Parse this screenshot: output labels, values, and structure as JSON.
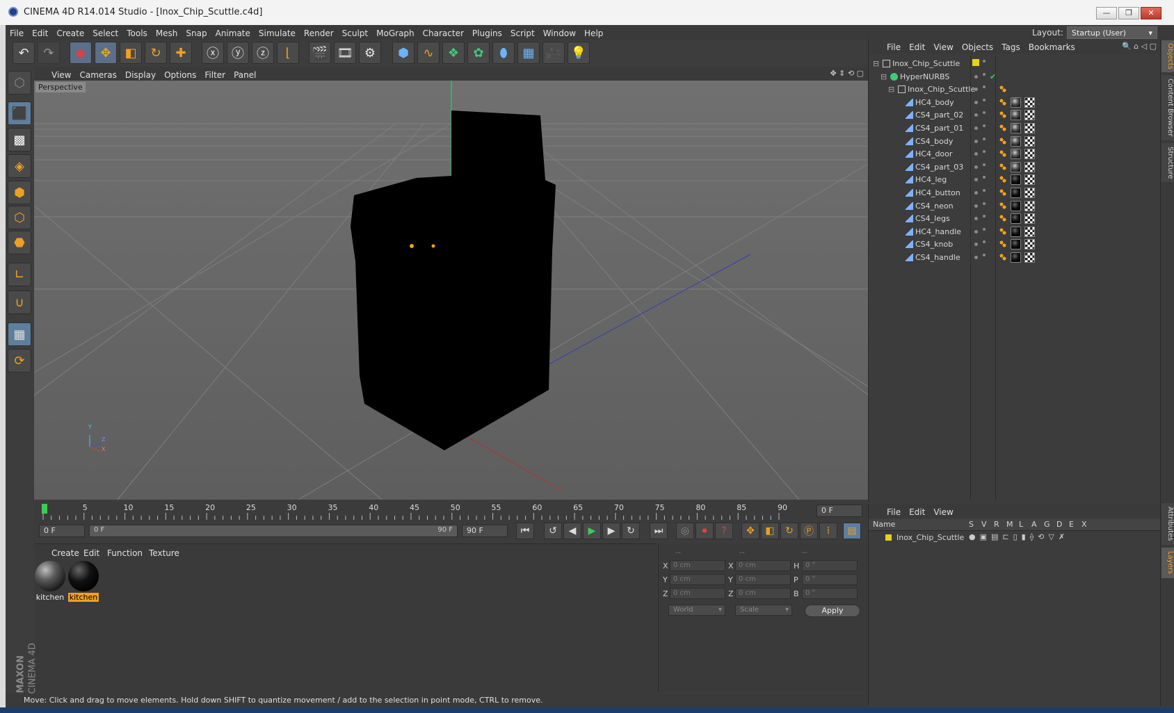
{
  "window": {
    "title": "CINEMA 4D R14.014 Studio - [Inox_Chip_Scuttle.c4d]",
    "controls": [
      "—",
      "❐",
      "✕"
    ]
  },
  "menubar": {
    "items": [
      "File",
      "Edit",
      "Create",
      "Select",
      "Tools",
      "Mesh",
      "Snap",
      "Animate",
      "Simulate",
      "Render",
      "Sculpt",
      "MoGraph",
      "Character",
      "Plugins",
      "Script",
      "Window",
      "Help"
    ],
    "layout_label": "Layout:",
    "layout_value": "Startup (User)"
  },
  "viewport": {
    "menu": [
      "View",
      "Cameras",
      "Display",
      "Options",
      "Filter",
      "Panel"
    ],
    "label": "Perspective",
    "axis": {
      "y": "Y",
      "z": "Z",
      "x": "X"
    }
  },
  "timeline": {
    "ticks": [
      "0",
      "5",
      "10",
      "15",
      "20",
      "25",
      "30",
      "35",
      "40",
      "45",
      "50",
      "55",
      "60",
      "65",
      "70",
      "75",
      "80",
      "85",
      "90"
    ],
    "current_frame_field": "0 F",
    "start_field": "0 F",
    "range_start": "0 F",
    "range_end": "90 F",
    "end_field": "90 F",
    "playhead_frame": 0
  },
  "material_manager": {
    "menu": [
      "Create",
      "Edit",
      "Function",
      "Texture"
    ],
    "materials": [
      {
        "label": "kitchen",
        "selected": false
      },
      {
        "label": "kitchen",
        "selected": true
      }
    ]
  },
  "coordinates": {
    "headers": [
      "--",
      "--",
      "--"
    ],
    "rows": [
      {
        "a_label": "X",
        "a_val": "0 cm",
        "b_label": "X",
        "b_val": "0 cm",
        "c_label": "H",
        "c_val": "0 °"
      },
      {
        "a_label": "Y",
        "a_val": "0 cm",
        "b_label": "Y",
        "b_val": "0 cm",
        "c_label": "P",
        "c_val": "0 °"
      },
      {
        "a_label": "Z",
        "a_val": "0 cm",
        "b_label": "Z",
        "b_val": "0 cm",
        "c_label": "B",
        "c_val": "0 °"
      }
    ],
    "mode1": "World",
    "mode2": "Scale",
    "apply": "Apply"
  },
  "object_manager": {
    "menu": [
      "File",
      "Edit",
      "View",
      "Objects",
      "Tags",
      "Bookmarks"
    ],
    "objects": [
      {
        "name": "Inox_Chip_Scuttle",
        "level": 0,
        "type": "null"
      },
      {
        "name": "HyperNURBS",
        "level": 1,
        "type": "hypernurbs"
      },
      {
        "name": "Inox_Chip_Scuttle",
        "level": 2,
        "type": "null"
      },
      {
        "name": "HC4_body",
        "level": 3,
        "type": "poly"
      },
      {
        "name": "CS4_part_02",
        "level": 3,
        "type": "poly"
      },
      {
        "name": "CS4_part_01",
        "level": 3,
        "type": "poly"
      },
      {
        "name": "CS4_body",
        "level": 3,
        "type": "poly"
      },
      {
        "name": "HC4_door",
        "level": 3,
        "type": "poly"
      },
      {
        "name": "CS4_part_03",
        "level": 3,
        "type": "poly"
      },
      {
        "name": "HC4_leg",
        "level": 3,
        "type": "poly"
      },
      {
        "name": "HC4_button",
        "level": 3,
        "type": "poly"
      },
      {
        "name": "CS4_neon",
        "level": 3,
        "type": "poly"
      },
      {
        "name": "CS4_legs",
        "level": 3,
        "type": "poly"
      },
      {
        "name": "HC4_handle",
        "level": 3,
        "type": "poly"
      },
      {
        "name": "CS4_knob",
        "level": 3,
        "type": "poly"
      },
      {
        "name": "CS4_handle",
        "level": 3,
        "type": "poly"
      }
    ]
  },
  "layer_manager": {
    "menu": [
      "File",
      "Edit",
      "View"
    ],
    "columns": [
      "Name",
      "S",
      "V",
      "R",
      "M",
      "L",
      "A",
      "G",
      "D",
      "E",
      "X"
    ],
    "layers": [
      {
        "name": "Inox_Chip_Scuttle",
        "color": "#e8d21a"
      }
    ]
  },
  "right_tabs": [
    "Objects",
    "Content Browser",
    "Structure",
    "Attributes",
    "Layers"
  ],
  "status": "Move: Click and drag to move elements. Hold down SHIFT to quantize movement / add to the selection in point mode, CTRL to remove.",
  "brand": {
    "maxon": "MAXON",
    "product": "CINEMA 4D"
  },
  "colors": {
    "accent": "#f0a020",
    "selection": "#5e7e9e",
    "layer_yellow": "#e8d21a"
  }
}
